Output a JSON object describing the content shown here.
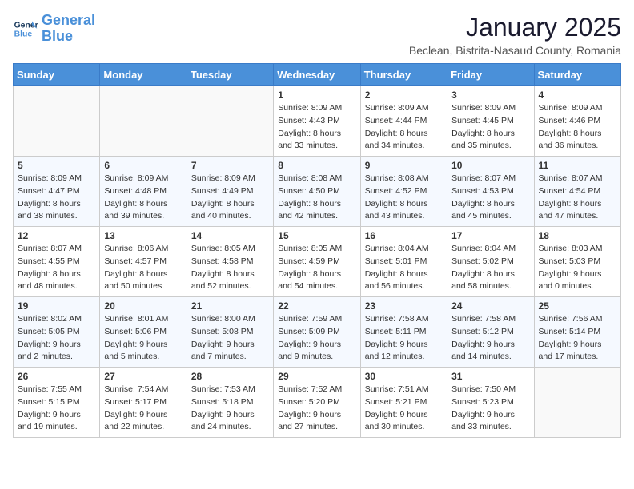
{
  "header": {
    "logo_line1": "General",
    "logo_line2": "Blue",
    "month": "January 2025",
    "location": "Beclean, Bistrita-Nasaud County, Romania"
  },
  "weekdays": [
    "Sunday",
    "Monday",
    "Tuesday",
    "Wednesday",
    "Thursday",
    "Friday",
    "Saturday"
  ],
  "weeks": [
    [
      {
        "day": "",
        "info": ""
      },
      {
        "day": "",
        "info": ""
      },
      {
        "day": "",
        "info": ""
      },
      {
        "day": "1",
        "info": "Sunrise: 8:09 AM\nSunset: 4:43 PM\nDaylight: 8 hours\nand 33 minutes."
      },
      {
        "day": "2",
        "info": "Sunrise: 8:09 AM\nSunset: 4:44 PM\nDaylight: 8 hours\nand 34 minutes."
      },
      {
        "day": "3",
        "info": "Sunrise: 8:09 AM\nSunset: 4:45 PM\nDaylight: 8 hours\nand 35 minutes."
      },
      {
        "day": "4",
        "info": "Sunrise: 8:09 AM\nSunset: 4:46 PM\nDaylight: 8 hours\nand 36 minutes."
      }
    ],
    [
      {
        "day": "5",
        "info": "Sunrise: 8:09 AM\nSunset: 4:47 PM\nDaylight: 8 hours\nand 38 minutes."
      },
      {
        "day": "6",
        "info": "Sunrise: 8:09 AM\nSunset: 4:48 PM\nDaylight: 8 hours\nand 39 minutes."
      },
      {
        "day": "7",
        "info": "Sunrise: 8:09 AM\nSunset: 4:49 PM\nDaylight: 8 hours\nand 40 minutes."
      },
      {
        "day": "8",
        "info": "Sunrise: 8:08 AM\nSunset: 4:50 PM\nDaylight: 8 hours\nand 42 minutes."
      },
      {
        "day": "9",
        "info": "Sunrise: 8:08 AM\nSunset: 4:52 PM\nDaylight: 8 hours\nand 43 minutes."
      },
      {
        "day": "10",
        "info": "Sunrise: 8:07 AM\nSunset: 4:53 PM\nDaylight: 8 hours\nand 45 minutes."
      },
      {
        "day": "11",
        "info": "Sunrise: 8:07 AM\nSunset: 4:54 PM\nDaylight: 8 hours\nand 47 minutes."
      }
    ],
    [
      {
        "day": "12",
        "info": "Sunrise: 8:07 AM\nSunset: 4:55 PM\nDaylight: 8 hours\nand 48 minutes."
      },
      {
        "day": "13",
        "info": "Sunrise: 8:06 AM\nSunset: 4:57 PM\nDaylight: 8 hours\nand 50 minutes."
      },
      {
        "day": "14",
        "info": "Sunrise: 8:05 AM\nSunset: 4:58 PM\nDaylight: 8 hours\nand 52 minutes."
      },
      {
        "day": "15",
        "info": "Sunrise: 8:05 AM\nSunset: 4:59 PM\nDaylight: 8 hours\nand 54 minutes."
      },
      {
        "day": "16",
        "info": "Sunrise: 8:04 AM\nSunset: 5:01 PM\nDaylight: 8 hours\nand 56 minutes."
      },
      {
        "day": "17",
        "info": "Sunrise: 8:04 AM\nSunset: 5:02 PM\nDaylight: 8 hours\nand 58 minutes."
      },
      {
        "day": "18",
        "info": "Sunrise: 8:03 AM\nSunset: 5:03 PM\nDaylight: 9 hours\nand 0 minutes."
      }
    ],
    [
      {
        "day": "19",
        "info": "Sunrise: 8:02 AM\nSunset: 5:05 PM\nDaylight: 9 hours\nand 2 minutes."
      },
      {
        "day": "20",
        "info": "Sunrise: 8:01 AM\nSunset: 5:06 PM\nDaylight: 9 hours\nand 5 minutes."
      },
      {
        "day": "21",
        "info": "Sunrise: 8:00 AM\nSunset: 5:08 PM\nDaylight: 9 hours\nand 7 minutes."
      },
      {
        "day": "22",
        "info": "Sunrise: 7:59 AM\nSunset: 5:09 PM\nDaylight: 9 hours\nand 9 minutes."
      },
      {
        "day": "23",
        "info": "Sunrise: 7:58 AM\nSunset: 5:11 PM\nDaylight: 9 hours\nand 12 minutes."
      },
      {
        "day": "24",
        "info": "Sunrise: 7:58 AM\nSunset: 5:12 PM\nDaylight: 9 hours\nand 14 minutes."
      },
      {
        "day": "25",
        "info": "Sunrise: 7:56 AM\nSunset: 5:14 PM\nDaylight: 9 hours\nand 17 minutes."
      }
    ],
    [
      {
        "day": "26",
        "info": "Sunrise: 7:55 AM\nSunset: 5:15 PM\nDaylight: 9 hours\nand 19 minutes."
      },
      {
        "day": "27",
        "info": "Sunrise: 7:54 AM\nSunset: 5:17 PM\nDaylight: 9 hours\nand 22 minutes."
      },
      {
        "day": "28",
        "info": "Sunrise: 7:53 AM\nSunset: 5:18 PM\nDaylight: 9 hours\nand 24 minutes."
      },
      {
        "day": "29",
        "info": "Sunrise: 7:52 AM\nSunset: 5:20 PM\nDaylight: 9 hours\nand 27 minutes."
      },
      {
        "day": "30",
        "info": "Sunrise: 7:51 AM\nSunset: 5:21 PM\nDaylight: 9 hours\nand 30 minutes."
      },
      {
        "day": "31",
        "info": "Sunrise: 7:50 AM\nSunset: 5:23 PM\nDaylight: 9 hours\nand 33 minutes."
      },
      {
        "day": "",
        "info": ""
      }
    ]
  ]
}
